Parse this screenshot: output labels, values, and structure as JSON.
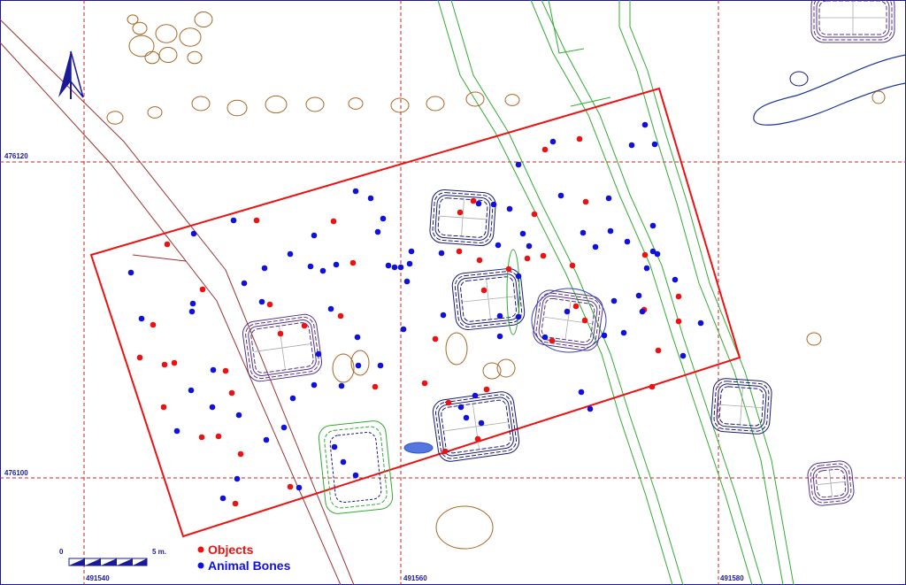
{
  "map": {
    "grid_labels": {
      "y_upper": "476120",
      "y_lower": "476100",
      "x_left": "491540",
      "x_mid": "491560",
      "x_right": "491580"
    },
    "scale": {
      "start": "0",
      "end": "5 m."
    },
    "legend": [
      {
        "label": "Objects",
        "color": "#ee1111"
      },
      {
        "label": "Animal Bones",
        "color": "#1111dd"
      }
    ],
    "north_arrow": "north-arrow-icon",
    "colors": {
      "excavation_outline": "#ee1111",
      "grid": "#cc2222",
      "channel": "#33aa33",
      "road": "#993333",
      "pit_brown": "#aa6622",
      "pit_navy": "#1a1a77",
      "pit_purple": "#553388"
    }
  }
}
